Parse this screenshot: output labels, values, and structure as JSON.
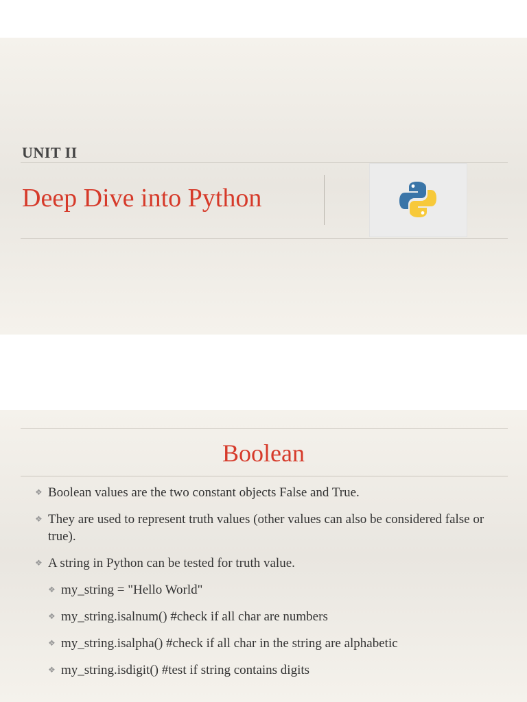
{
  "slide1": {
    "unit": "UNIT II",
    "title": "Deep Dive into Python",
    "logo_icon": "python-logo-icon",
    "colors": {
      "title": "#d63a2a",
      "python_blue": "#3a75a8",
      "python_yellow": "#f7c93a"
    }
  },
  "slide2": {
    "title": "Boolean",
    "bullets": [
      {
        "level": 1,
        "text": "Boolean values are the two constant objects False and True."
      },
      {
        "level": 1,
        "text": "They are used to represent truth values (other values can also be considered false or true)."
      },
      {
        "level": 1,
        "text": "A string in Python can be tested for truth value."
      },
      {
        "level": 2,
        "text": "my_string = \"Hello World\""
      },
      {
        "level": 2,
        "text": "my_string.isalnum()  #check if all char are numbers"
      },
      {
        "level": 2,
        "text": "my_string.isalpha()  #check if all char in the string are alphabetic"
      },
      {
        "level": 2,
        "text": "my_string.isdigit()  #test if string contains digits"
      }
    ],
    "bullet_glyph": "❖"
  }
}
